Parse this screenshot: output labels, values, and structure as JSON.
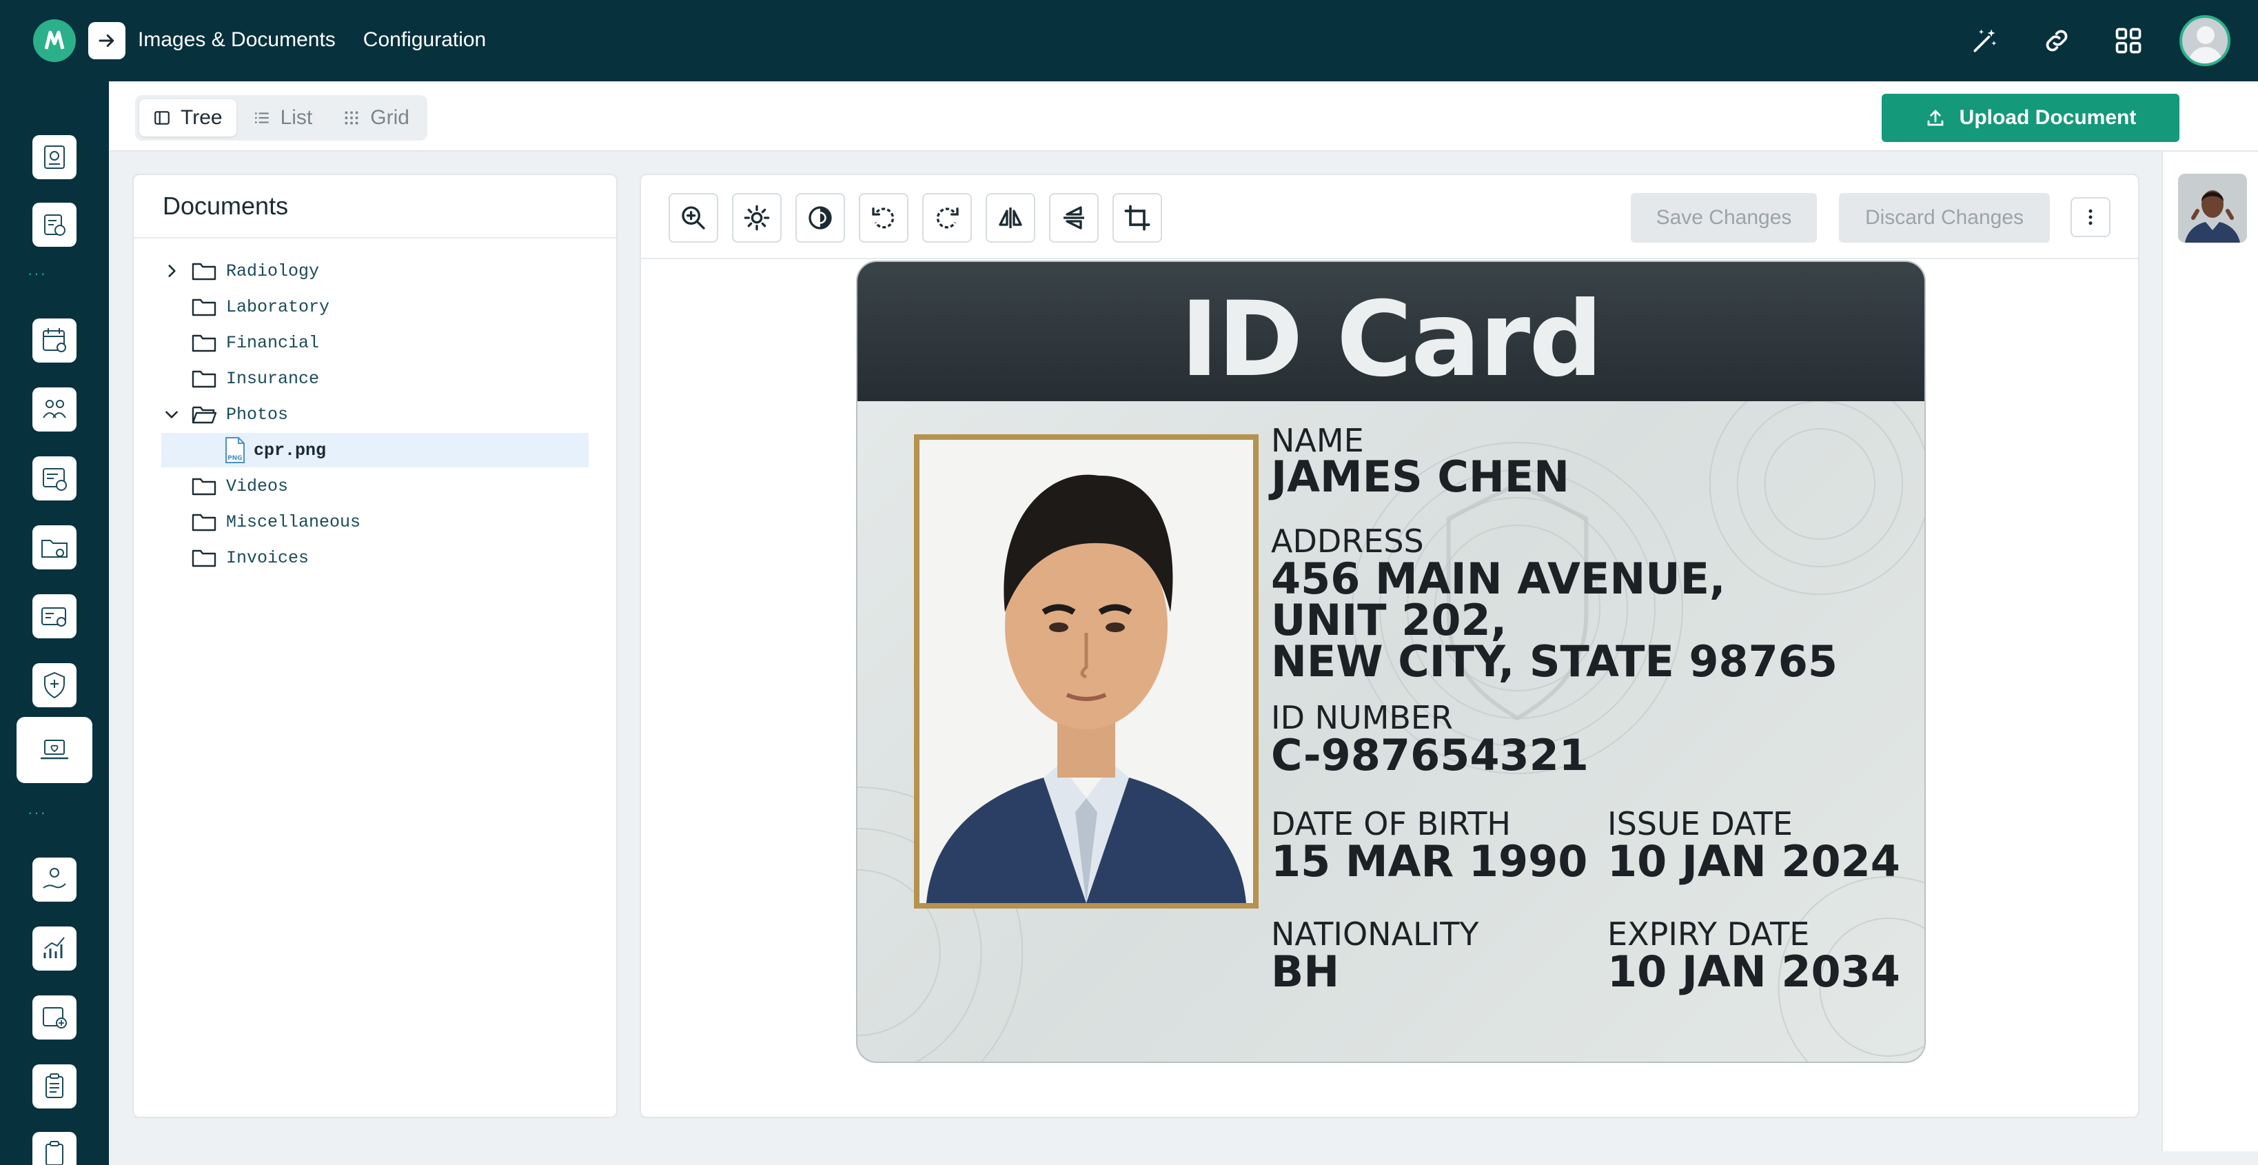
{
  "header": {
    "nav": [
      "Images & Documents",
      "Configuration"
    ],
    "icons": [
      "magic-wand-icon",
      "link-icon",
      "apps-grid-icon",
      "user-avatar"
    ]
  },
  "rail": {
    "items": [
      "pediatric-chart-icon",
      "lab-results-icon",
      "appointments-calendar-icon",
      "care-team-icon",
      "billing-icon",
      "id-card-folder-icon",
      "insurance-card-icon",
      "health-protection-icon",
      "telehealth-laptop-icon",
      "patient-care-icon",
      "analytics-chart-icon",
      "medical-records-icon",
      "clipboard-icon",
      "clipboard-tasks-icon"
    ],
    "active_index": 8
  },
  "view_switch": {
    "options": [
      "Tree",
      "List",
      "Grid"
    ],
    "selected": "Tree"
  },
  "upload_button": "Upload Document",
  "documents": {
    "title": "Documents",
    "tree": [
      {
        "name": "Radiology",
        "type": "folder",
        "expandable": true,
        "expanded": false
      },
      {
        "name": "Laboratory",
        "type": "folder"
      },
      {
        "name": "Financial",
        "type": "folder"
      },
      {
        "name": "Insurance",
        "type": "folder"
      },
      {
        "name": "Photos",
        "type": "folder",
        "expanded": true
      },
      {
        "name": "cpr.png",
        "type": "file",
        "selected": true,
        "badge": "PNG"
      },
      {
        "name": "Videos",
        "type": "folder"
      },
      {
        "name": "Miscellaneous",
        "type": "folder"
      },
      {
        "name": "Invoices",
        "type": "folder"
      }
    ]
  },
  "viewer": {
    "tools": [
      "zoom-in-icon",
      "brightness-icon",
      "contrast-icon",
      "rotate-left-icon",
      "rotate-right-icon",
      "flip-horizontal-icon",
      "flip-vertical-icon",
      "crop-icon"
    ],
    "save_label": "Save Changes",
    "discard_label": "Discard Changes",
    "image": {
      "title": "ID Card",
      "name_label": "NAME",
      "name_value": "JAMES CHEN",
      "address_label": "ADDRESS",
      "address_lines": [
        "456 MAIN AVENUE,",
        "UNIT 202,",
        "NEW CITY, STATE 98765"
      ],
      "id_label": "ID NUMBER",
      "id_value": "C-987654321",
      "dob_label": "DATE OF BIRTH",
      "dob_value": "15 MAR 1990",
      "issue_label": "ISSUE DATE",
      "issue_value": "10 JAN 2024",
      "nationality_label": "NATIONALITY",
      "nationality_value": "BH",
      "expiry_label": "EXPIRY DATE",
      "expiry_value": "10 JAN 2034"
    }
  },
  "colors": {
    "header_bg": "#06313d",
    "accent": "#14997a",
    "selected_row": "#e6f1fb"
  }
}
